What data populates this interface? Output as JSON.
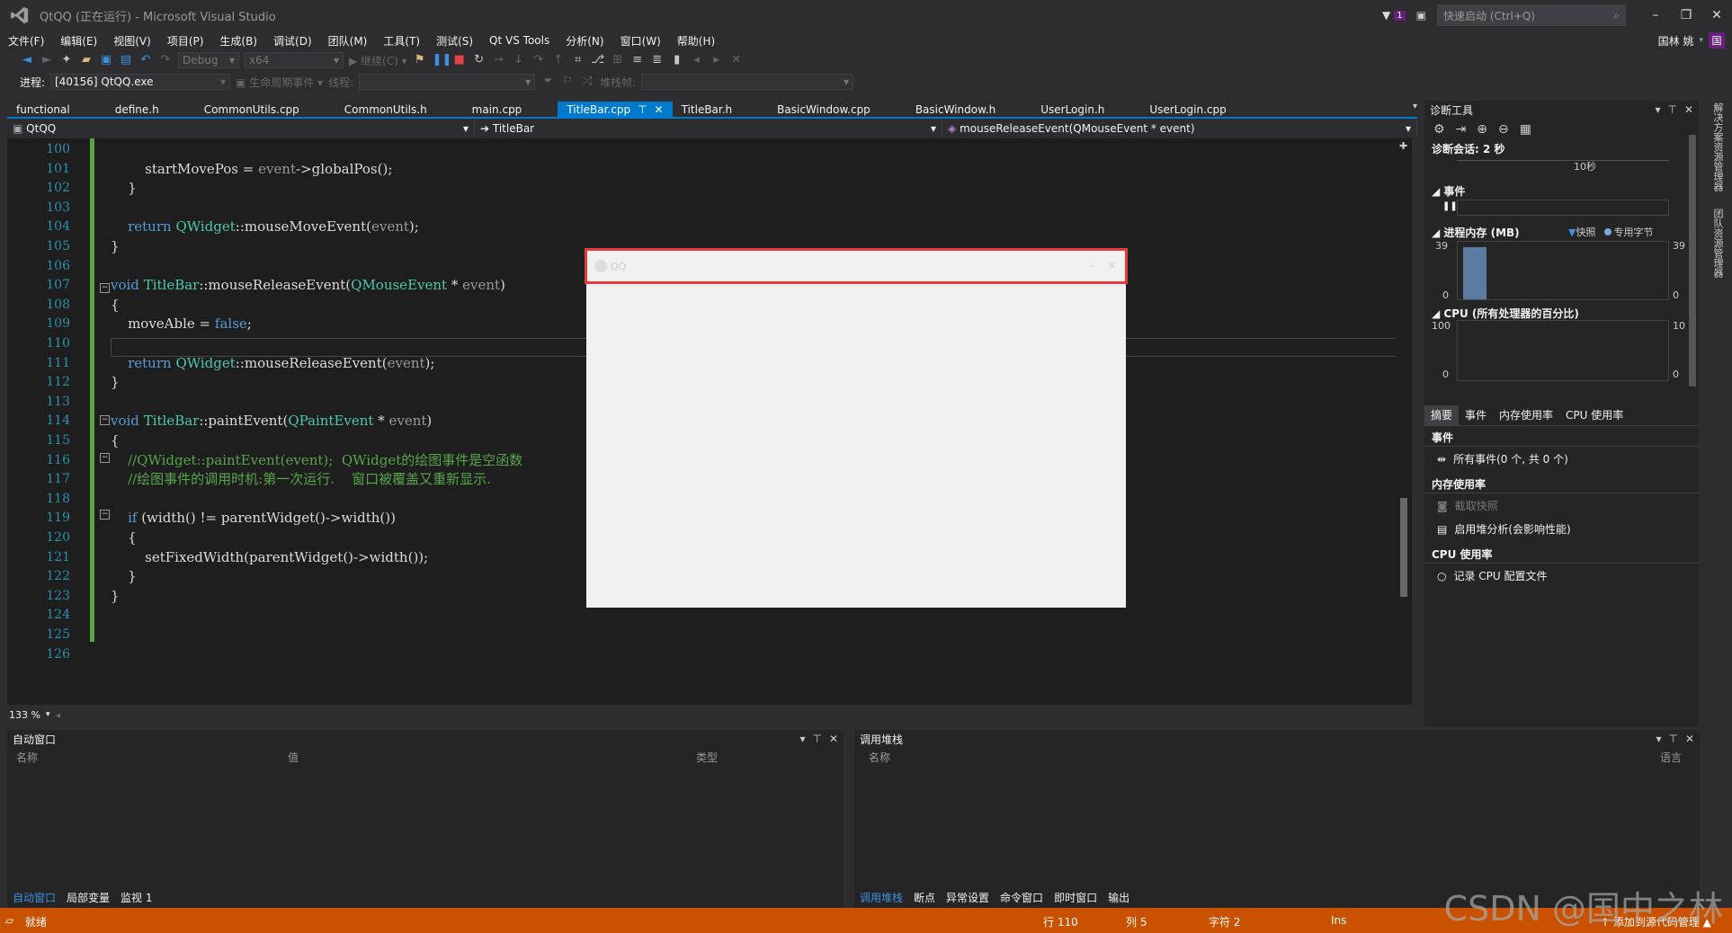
{
  "window": {
    "title": "QtQQ (正在运行) - Microsoft Visual Studio",
    "quick_launch_placeholder": "快速启动 (Ctrl+Q)",
    "notif_count": "1",
    "user": "国林 姚",
    "avatar_initial": "国"
  },
  "menu": [
    "文件(F)",
    "编辑(E)",
    "视图(V)",
    "项目(P)",
    "生成(B)",
    "调试(D)",
    "团队(M)",
    "工具(T)",
    "测试(S)",
    "Qt VS Tools",
    "分析(N)",
    "窗口(W)",
    "帮助(H)"
  ],
  "toolbar": {
    "config": "Debug",
    "platform": "x64",
    "continue_label": "继续(C)",
    "process_label": "进程:",
    "process_value": "[40156] QtQQ.exe",
    "lifecycle_label": "生命周期事件",
    "thread_label": "线程:",
    "stack_label": "堆栈帧:"
  },
  "tabs": [
    "functional",
    "define.h",
    "CommonUtils.cpp",
    "CommonUtils.h",
    "main.cpp",
    "TitleBar.cpp",
    "TitleBar.h",
    "BasicWindow.cpp",
    "BasicWindow.h",
    "UserLogin.h",
    "UserLogin.cpp"
  ],
  "active_tab": "TitleBar.cpp",
  "navbar": {
    "project": "QtQQ",
    "scope": "TitleBar",
    "member": "mouseReleaseEvent(QMouseEvent * event)"
  },
  "editor": {
    "zoom": "133 %",
    "lines": [
      {
        "n": "100",
        "code": ""
      },
      {
        "n": "101",
        "code": "        startMovePos = event->globalPos();"
      },
      {
        "n": "102",
        "code": "    }"
      },
      {
        "n": "103",
        "code": ""
      },
      {
        "n": "104",
        "code": "    return QWidget::mouseMoveEvent(event);"
      },
      {
        "n": "105",
        "code": "}"
      },
      {
        "n": "106",
        "code": ""
      },
      {
        "n": "107",
        "code": "void TitleBar::mouseReleaseEvent(QMouseEvent * event)"
      },
      {
        "n": "108",
        "code": "{"
      },
      {
        "n": "109",
        "code": "    moveAble = false;"
      },
      {
        "n": "110",
        "code": ""
      },
      {
        "n": "111",
        "code": "    return QWidget::mouseReleaseEvent(event);"
      },
      {
        "n": "112",
        "code": "}"
      },
      {
        "n": "113",
        "code": ""
      },
      {
        "n": "114",
        "code": "void TitleBar::paintEvent(QPaintEvent * event)"
      },
      {
        "n": "115",
        "code": "{"
      },
      {
        "n": "116",
        "code": "    //QWidget::paintEvent(event);  QWidget的绘图事件是空函数"
      },
      {
        "n": "117",
        "code": "    //绘图事件的调用时机:第一次运行.    窗口被覆盖又重新显示."
      },
      {
        "n": "118",
        "code": ""
      },
      {
        "n": "119",
        "code": "    if (width() != parentWidget()->width())"
      },
      {
        "n": "120",
        "code": "    {"
      },
      {
        "n": "121",
        "code": "        setFixedWidth(parentWidget()->width());"
      },
      {
        "n": "122",
        "code": "    }"
      },
      {
        "n": "123",
        "code": "}"
      },
      {
        "n": "124",
        "code": ""
      },
      {
        "n": "125",
        "code": ""
      },
      {
        "n": "126",
        "code": ""
      }
    ]
  },
  "app_window": {
    "title": "QQ"
  },
  "diag": {
    "title": "诊断工具",
    "session": "诊断会话: 2 秒",
    "timeline_label": "10秒",
    "events_label": "事件",
    "memory_label": "进程内存 (MB)",
    "legend_snapshot": "快照",
    "legend_private": "专用字节",
    "mem_max_left": "39",
    "mem_min_left": "0",
    "mem_max_right": "39",
    "mem_min_right": "0",
    "cpu_label": "CPU (所有处理器的百分比)",
    "cpu_max_left": "100",
    "cpu_min_left": "0",
    "cpu_max_right": "10",
    "cpu_min_right": "0",
    "tabs": [
      "摘要",
      "事件",
      "内存使用率",
      "CPU 使用率"
    ],
    "sec_events": "事件",
    "all_events": "所有事件(0 个, 共 0 个)",
    "sec_memory": "内存使用率",
    "take_snapshot": "截取快照",
    "heap_analysis": "启用堆分析(会影响性能)",
    "sec_cpu": "CPU 使用率",
    "record_cpu": "记录 CPU 配置文件"
  },
  "side_strip": [
    "解决方案资源管理器",
    "团队资源管理器"
  ],
  "auto_panel": {
    "title": "自动窗口",
    "col_name": "名称",
    "col_value": "值",
    "col_type": "类型",
    "tabs": [
      "自动窗口",
      "局部变量",
      "监视 1"
    ]
  },
  "call_panel": {
    "title": "调用堆栈",
    "col_name": "名称",
    "col_lang": "语言",
    "tabs": [
      "调用堆栈",
      "断点",
      "异常设置",
      "命令窗口",
      "即时窗口",
      "输出"
    ]
  },
  "status": {
    "ready": "就绪",
    "line": "行 110",
    "col": "列 5",
    "char": "字符 2",
    "ins": "Ins",
    "add_source": "↑ 添加到源代码管理 ▲"
  },
  "watermark": "CSDN @国中之林"
}
